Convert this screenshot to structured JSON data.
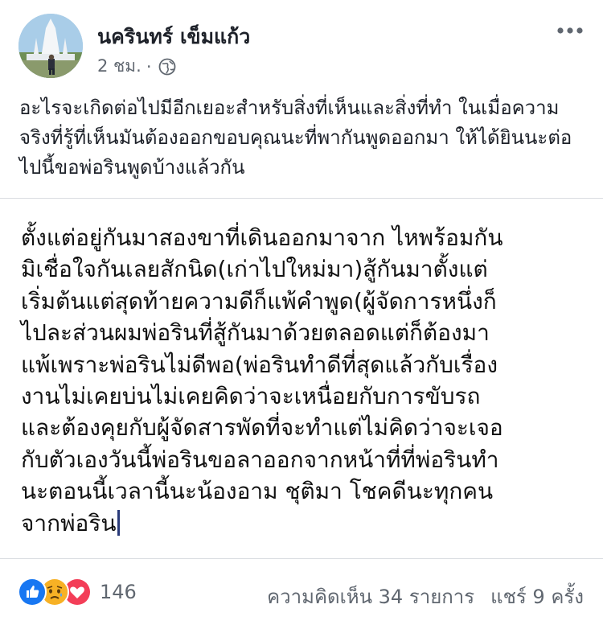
{
  "post": {
    "author": "นครินทร์ เข็มแก้ว",
    "time": "2 ชม.",
    "separator": "·",
    "privacy_icon": "globe-icon",
    "menu_icon": "more-options-icon",
    "caption": "อะไรจะเกิดต่อไปมีอีกเยอะสำหรับสิ่งที่เห็นและสิ่งที่ทำ ในเมื่อความจริงที่รู้ที่เห็นมันต้องออกขอบคุณนะที่พากันพูดออกมา ให้ได้ยินนะต่อไปนี้ขอพ่อรินพูดบ้างแล้วกัน"
  },
  "image_text": {
    "lines": [
      "ตั้งแต่อยู่กันมาสองขาที่เดินออกมาจาก ไหพร้อมกัน",
      "มิเชื่อใจกันเลยสักนิด(เก่าไปใหม่มา)สู้กันมาตั้งแต่",
      "เริ่มต้นแต่สุดท้ายความดีก็แพ้คำพูด(ผู้จัดการหนึ่งก็",
      "ไปละส่วนผมพ่อรินที่สู้กันมาด้วยตลอดแต่ก็ต้องมา",
      "แพ้เพราะพ่อรินไม่ดีพอ(พ่อรินทำดีที่สุดแล้วกับเรื่อง",
      "งานไม่เคยบ่นไม่เคยคิดว่าจะเหนื่อยกับการขับรถ",
      "และต้องคุยกับผู้จัดสารพัดที่จะทำแต่ไม่คิดว่าจะเจอ",
      "กับตัวเองวันนี้พ่อรินขอลาออกจากหน้าที่ที่พ่อรินทำ",
      "นะตอนนี้เวลานี้นะน้องอาม ชุติมา  โชคดีนะทุกคน",
      "จากพ่อริน"
    ]
  },
  "footer": {
    "reaction_icons": [
      "like-icon",
      "sad-icon",
      "love-icon"
    ],
    "reaction_count": "146",
    "comments": "ความคิดเห็น 34 รายการ",
    "shares": "แชร์ 9 ครั้ง"
  },
  "colors": {
    "like": "#1877f2",
    "love": "#f33e58",
    "sad": "#f7b125",
    "muted_text": "#606770",
    "divider": "#dadde1"
  }
}
